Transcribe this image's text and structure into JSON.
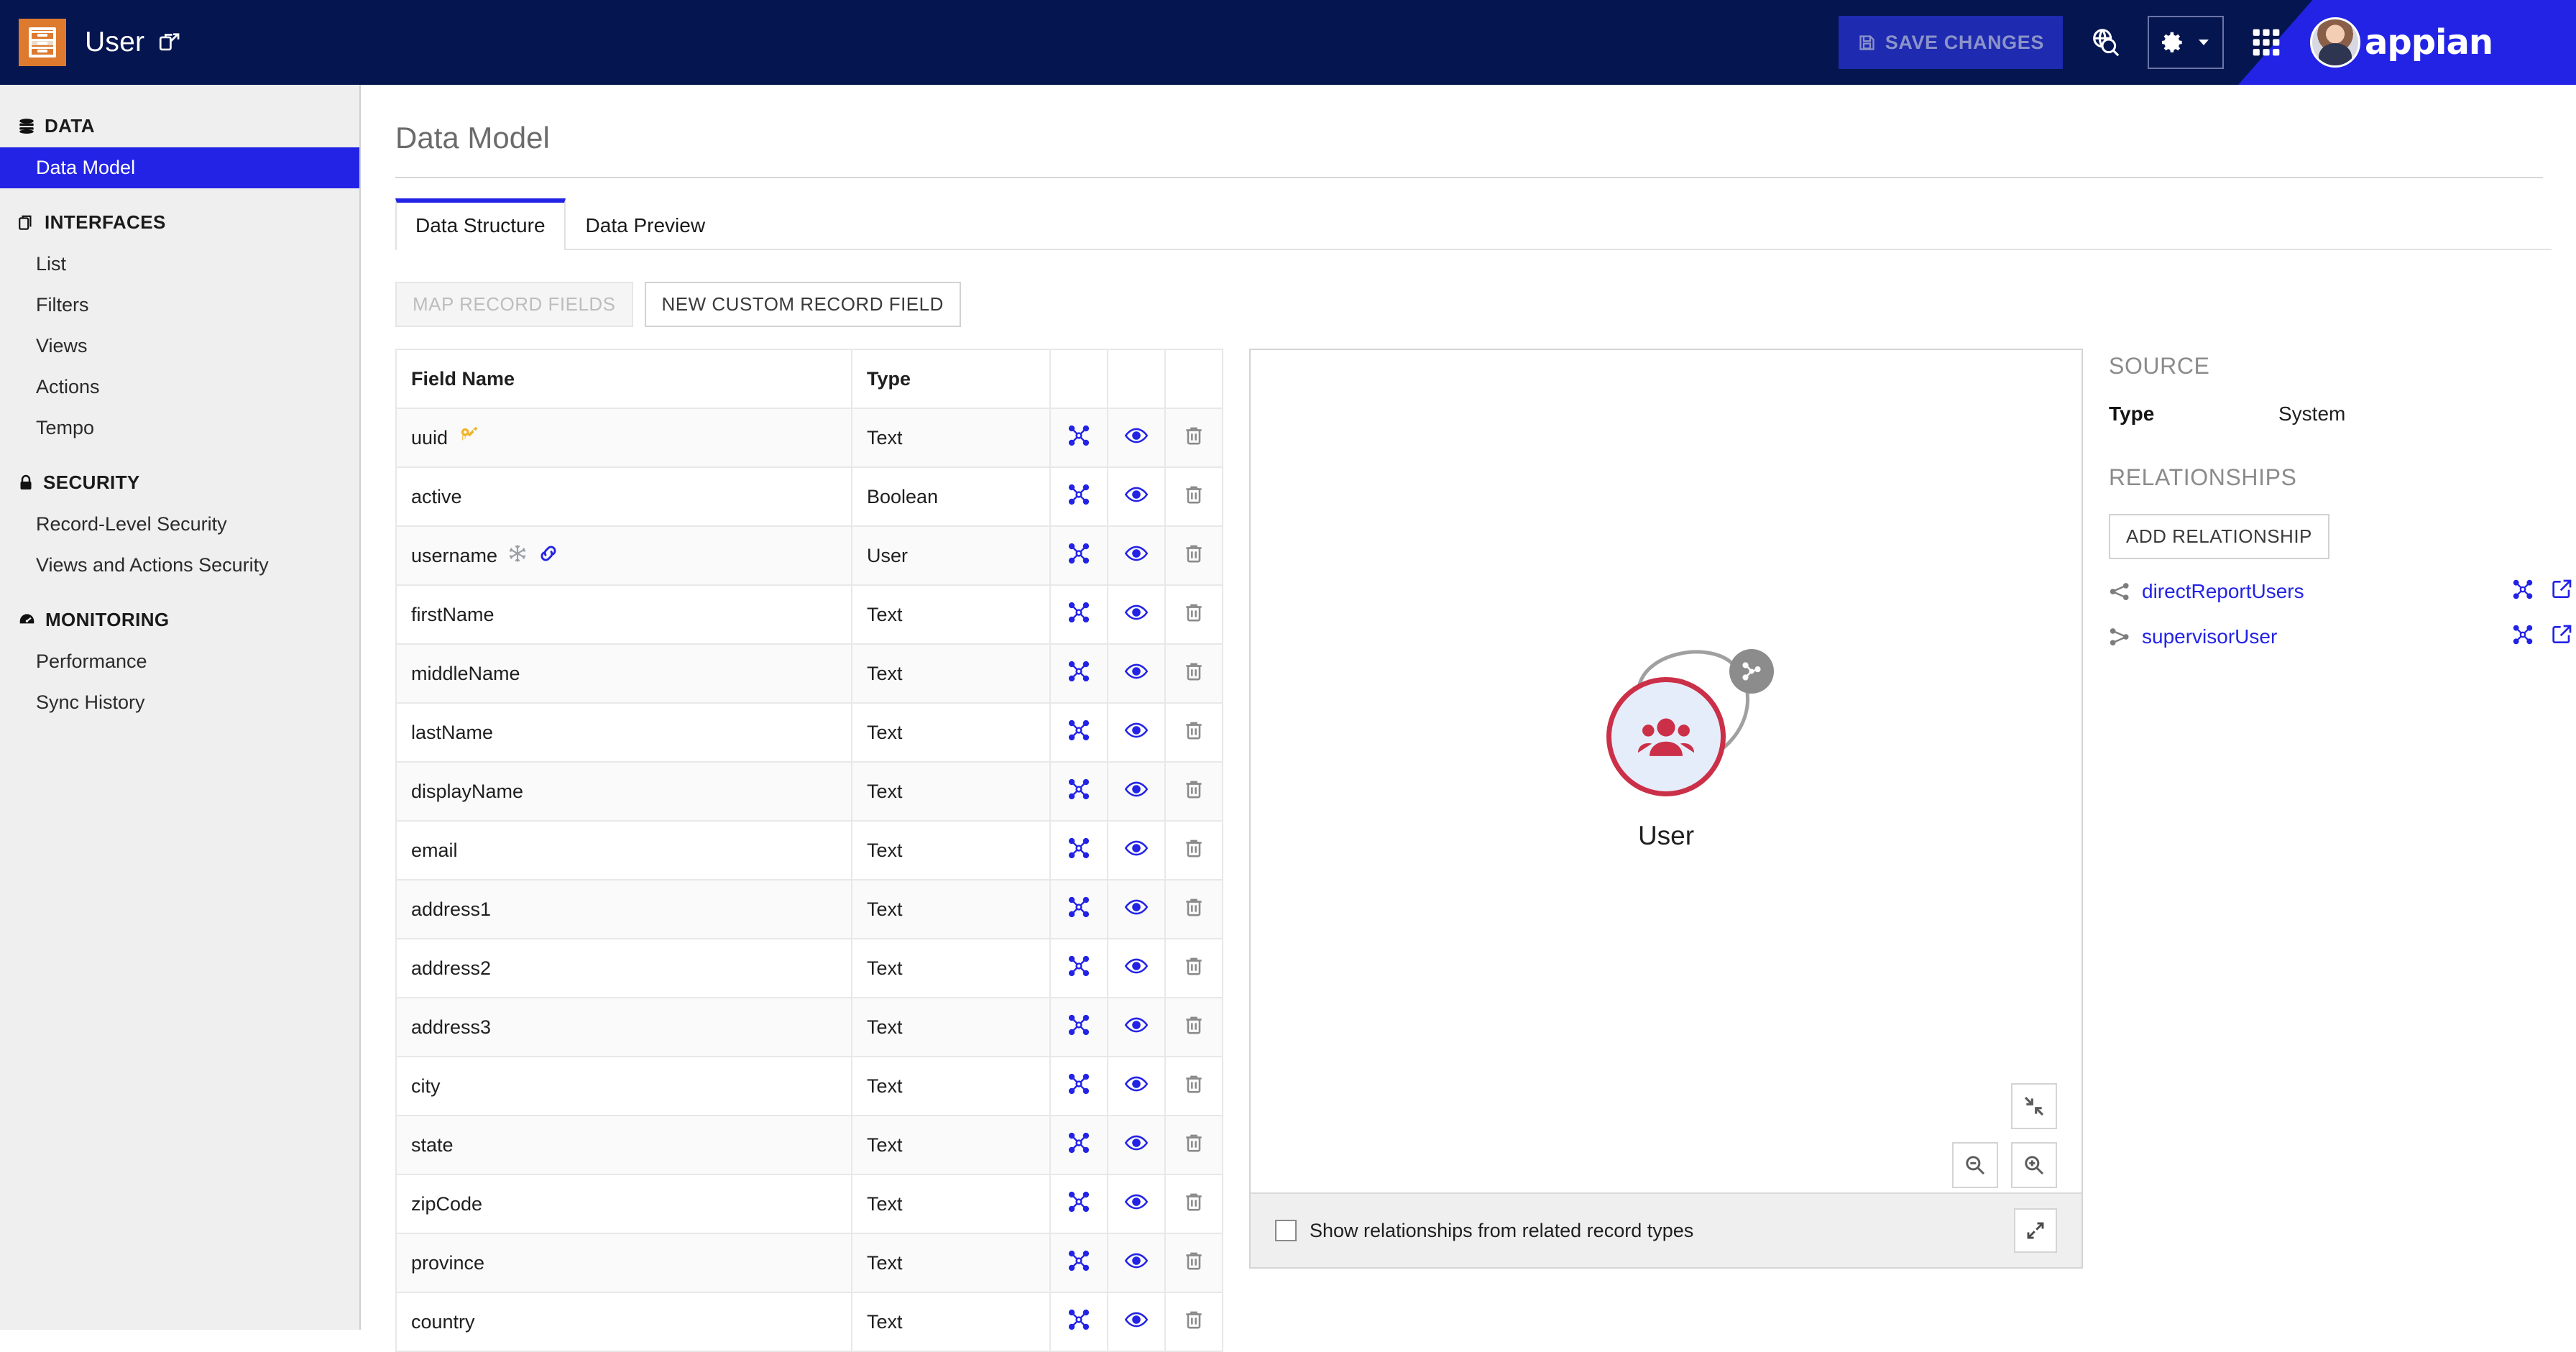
{
  "header": {
    "record_icon": "record-type-cabinet-icon",
    "title": "User",
    "external_link_icon": "open-external-icon",
    "save_label": "SAVE CHANGES",
    "save_icon": "floppy-save-icon",
    "search_icon": "globe-search-icon",
    "settings_icon": "gear-icon",
    "settings_caret_icon": "chevron-down-icon",
    "apps_icon": "apps-grid-icon",
    "avatar": "user-avatar",
    "logo": "appian"
  },
  "sidebar": {
    "sections": [
      {
        "label": "DATA",
        "icon": "database-icon",
        "items": [
          {
            "label": "Data Model",
            "active": true
          }
        ]
      },
      {
        "label": "INTERFACES",
        "icon": "copy-pages-icon",
        "items": [
          {
            "label": "List",
            "active": false
          },
          {
            "label": "Filters",
            "active": false
          },
          {
            "label": "Views",
            "active": false
          },
          {
            "label": "Actions",
            "active": false
          },
          {
            "label": "Tempo",
            "active": false
          }
        ]
      },
      {
        "label": "SECURITY",
        "icon": "lock-icon",
        "items": [
          {
            "label": "Record-Level Security",
            "active": false
          },
          {
            "label": "Views and Actions Security",
            "active": false
          }
        ]
      },
      {
        "label": "MONITORING",
        "icon": "gauge-icon",
        "items": [
          {
            "label": "Performance",
            "active": false
          },
          {
            "label": "Sync History",
            "active": false
          }
        ]
      }
    ]
  },
  "main": {
    "page_title": "Data Model",
    "tabs": [
      {
        "label": "Data Structure",
        "active": true
      },
      {
        "label": "Data Preview",
        "active": false
      }
    ],
    "buttons": {
      "map_record_fields": "MAP RECORD FIELDS",
      "new_custom_record_field": "NEW CUSTOM RECORD FIELD"
    }
  },
  "table": {
    "columns": [
      "Field Name",
      "Type",
      "",
      "",
      ""
    ],
    "row_icons": {
      "relationship": "relationship-nodes-icon",
      "view": "eye-icon",
      "delete": "trash-icon"
    },
    "rows": [
      {
        "name": "uuid",
        "type": "Text",
        "badges": [
          "primary-key-icon"
        ]
      },
      {
        "name": "active",
        "type": "Boolean",
        "badges": []
      },
      {
        "name": "username",
        "type": "User",
        "badges": [
          "snowflake-icon",
          "link-icon"
        ]
      },
      {
        "name": "firstName",
        "type": "Text",
        "badges": []
      },
      {
        "name": "middleName",
        "type": "Text",
        "badges": []
      },
      {
        "name": "lastName",
        "type": "Text",
        "badges": []
      },
      {
        "name": "displayName",
        "type": "Text",
        "badges": []
      },
      {
        "name": "email",
        "type": "Text",
        "badges": []
      },
      {
        "name": "address1",
        "type": "Text",
        "badges": []
      },
      {
        "name": "address2",
        "type": "Text",
        "badges": []
      },
      {
        "name": "address3",
        "type": "Text",
        "badges": []
      },
      {
        "name": "city",
        "type": "Text",
        "badges": []
      },
      {
        "name": "state",
        "type": "Text",
        "badges": []
      },
      {
        "name": "zipCode",
        "type": "Text",
        "badges": []
      },
      {
        "name": "province",
        "type": "Text",
        "badges": []
      },
      {
        "name": "country",
        "type": "Text",
        "badges": []
      }
    ]
  },
  "diagram": {
    "node_label": "User",
    "node_icon": "people-group-icon",
    "self_relationship_icon": "relationship-nodes-icon",
    "controls": {
      "fit": "fit-to-screen-icon",
      "zoom_out": "zoom-out-icon",
      "zoom_in": "zoom-in-icon",
      "expand": "expand-diagonal-icon"
    },
    "footer": {
      "checkbox_label": "Show relationships from related record types",
      "checkbox_checked": false
    },
    "colors": {
      "node_border": "#cb3048",
      "node_fill": "#e5edfa"
    }
  },
  "right_panel": {
    "source_heading": "SOURCE",
    "source_type_key": "Type",
    "source_type_value": "System",
    "relationships_heading": "RELATIONSHIPS",
    "add_relationship_label": "ADD RELATIONSHIP",
    "relationships": [
      {
        "name": "directReportUsers",
        "kind_icon": "one-to-many-icon"
      },
      {
        "name": "supervisorUser",
        "kind_icon": "many-to-one-icon"
      }
    ],
    "row_icons": {
      "relationship": "relationship-nodes-icon",
      "edit": "open-edit-icon",
      "delete": "trash-icon"
    }
  },
  "colors": {
    "topbar": "#05154f",
    "accent_blue": "#2323e6",
    "record_orange": "#dd7a2e",
    "sidebar_bg": "#efeff0"
  }
}
